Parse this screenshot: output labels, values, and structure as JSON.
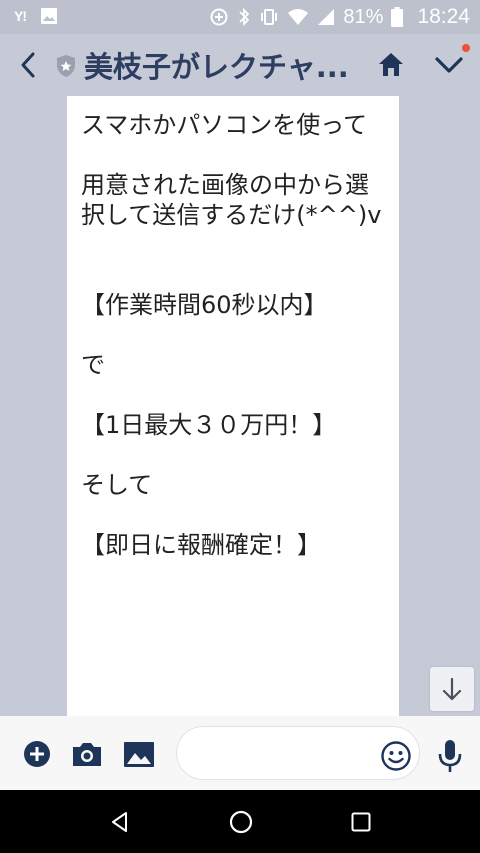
{
  "status_bar": {
    "left_icons": [
      "yahoo-icon",
      "image-icon"
    ],
    "yahoo_text": "Y!",
    "battery_percent": "81%",
    "time": "18:24"
  },
  "header": {
    "title": "美枝子がレクチャ...",
    "has_notification_dot": true
  },
  "message": {
    "text": "スマホかパソコンを使って\n\n用意された画像の中から選択して送信するだけ(*^^)v\n\n\n【作業時間60秒以内】\n\nで\n\n【1日最大３０万円！】\n\nそして\n\n【即日に報酬確定！】"
  },
  "input_bar": {
    "placeholder": ""
  },
  "colors": {
    "header_bg": "#c5cad6",
    "title": "#2d3e60",
    "icon": "#1f3459",
    "notify": "#f0513a"
  }
}
